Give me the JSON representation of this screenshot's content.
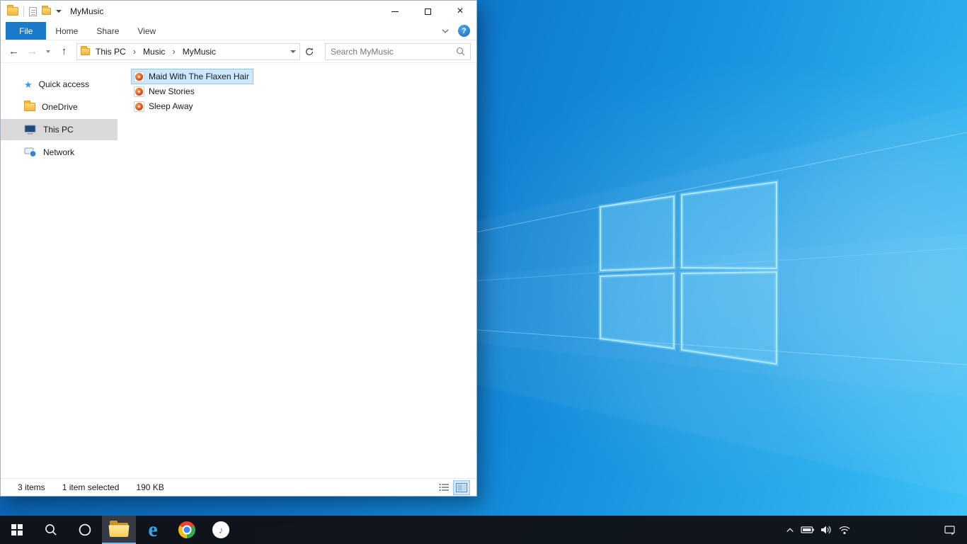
{
  "window": {
    "title": "MyMusic",
    "ribbon": {
      "tabs": [
        "File",
        "Home",
        "Share",
        "View"
      ]
    },
    "address": {
      "crumbs": [
        "This PC",
        "Music",
        "MyMusic"
      ],
      "search_placeholder": "Search MyMusic"
    },
    "sidebar": {
      "items": [
        {
          "label": "Quick access"
        },
        {
          "label": "OneDrive"
        },
        {
          "label": "This PC"
        },
        {
          "label": "Network"
        }
      ],
      "selected": "This PC"
    },
    "files": [
      {
        "name": "Maid With The Flaxen Hair",
        "selected": true
      },
      {
        "name": "New Stories",
        "selected": false
      },
      {
        "name": "Sleep Away",
        "selected": false
      }
    ],
    "status": {
      "count": "3 items",
      "selection": "1 item selected",
      "size": "190 KB"
    }
  },
  "glyphs": {
    "close": "×",
    "back": "←",
    "forward": "→",
    "up": "↑",
    "crumb_sep": "›",
    "help": "?",
    "star": "★",
    "note": "♪",
    "edge": "e"
  },
  "colors": {
    "accent": "#1979ca",
    "file_selection_bg": "#cce8ff",
    "file_selection_border": "#90c8f6",
    "nav_selection_bg": "#d9d9d9",
    "taskbar_bg": "#101117",
    "desktop_blue": "#1590dd",
    "folder_yellow": "#f2b43d"
  },
  "taskbar": {
    "apps": [
      "start",
      "search",
      "cortana",
      "file-explorer",
      "edge",
      "chrome",
      "itunes"
    ],
    "active_app": "file-explorer",
    "tray": [
      "hidden-icons",
      "battery",
      "volume",
      "network",
      "action-center"
    ]
  }
}
